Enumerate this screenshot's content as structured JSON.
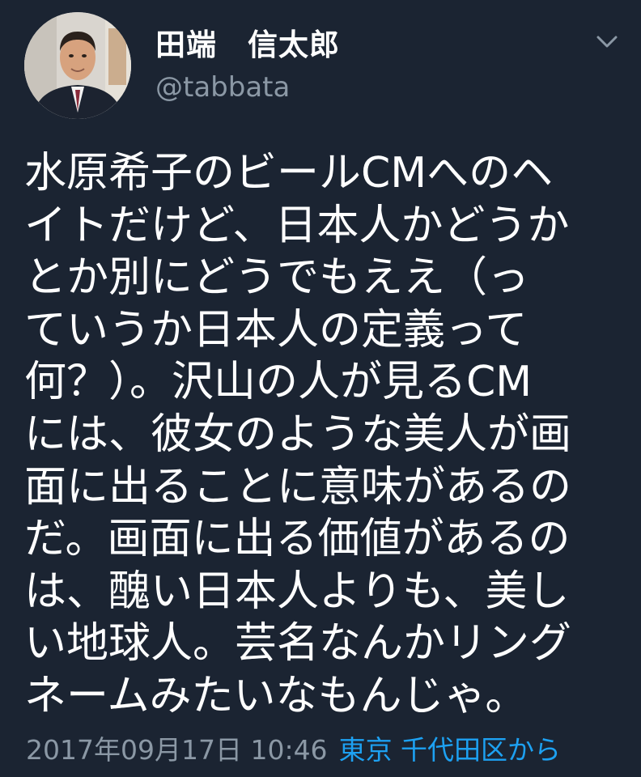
{
  "author": {
    "display_name": "田端　信太郎",
    "handle": "@tabbata",
    "avatar_icon": "avatar-photo"
  },
  "tweet": {
    "text": "水原希子のビールCMへのヘ\nイトだけど、日本人かどうか\nとか別にどうでもええ（っ\nていうか日本人の定義って\n何？）。沢山の人が見るCM\nには、彼女のような美人が画\n面に出ることに意味があるの\nだ。画面に出る価値があるの\nは、醜い日本人よりも、美し\nい地球人。芸名なんかリング\nネームみたいなもんじゃ。",
    "timestamp": "2017年09月17日 10:46",
    "location": "東京 千代田区から"
  },
  "colors": {
    "background": "#1b2432",
    "text": "#ffffff",
    "secondary": "#8b98a5",
    "link": "#1da1f2"
  },
  "icons": {
    "menu": "chevron-down-icon"
  }
}
